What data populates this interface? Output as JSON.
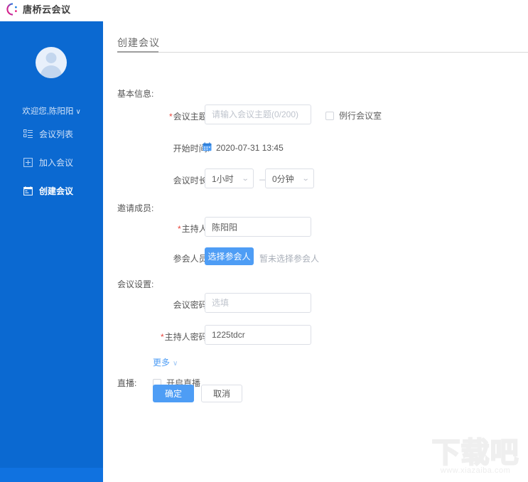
{
  "app": {
    "brand_name": "唐桥云会议",
    "logo_icon": "circle-c-logo-icon"
  },
  "sidebar": {
    "avatar_icon": "user-avatar-icon",
    "welcome_text": "欢迎您,陈阳阳",
    "welcome_chevron": "∨",
    "items": [
      {
        "label": "会议列表",
        "icon": "list-icon",
        "active": false
      },
      {
        "label": "加入会议",
        "icon": "plus-box-icon",
        "active": false
      },
      {
        "label": "创建会议",
        "icon": "calendar-create-icon",
        "active": true
      }
    ]
  },
  "main": {
    "page_title": "创建会议",
    "sections": {
      "basic_info": "基本信息:",
      "invite_members": "邀请成员:",
      "meeting_settings": "会议设置:"
    },
    "basic": {
      "subject_label": "会议主题:",
      "subject_required": "*",
      "subject_value": "",
      "subject_placeholder": "请输入会议主题(0/200)",
      "routine_room_label": "例行会议室",
      "routine_room_checked": false,
      "start_time_label": "开始时间:",
      "start_time_value": "2020-07-31 13:45",
      "calendar_icon": "calendar-icon",
      "duration_label": "会议时长:",
      "duration_hours": "1小时",
      "duration_minutes": "0分钟",
      "duration_separator": "—",
      "chevron_icon": "chevron-down-icon"
    },
    "invite": {
      "host_label": "主持人:",
      "host_required": "*",
      "host_value": "陈阳阳",
      "attendee_label": "参会人员:",
      "select_attendee_button": "选择参会人",
      "attendee_hint": "暂未选择参会人"
    },
    "settings": {
      "meeting_password_label": "会议密码:",
      "meeting_password_value": "",
      "meeting_password_placeholder": "选填",
      "host_password_label": "主持人密码:",
      "host_password_required": "*",
      "host_password_value": "1225tdcr",
      "more_label": "更多",
      "more_chevron": "∨"
    },
    "live": {
      "label": "直播:",
      "enable_label": "开启直播",
      "enable_checked": false
    },
    "actions": {
      "confirm": "确定",
      "cancel": "取消"
    }
  },
  "watermark": {
    "big_text": "下载吧",
    "small_text": "www.xiazaiba.com"
  },
  "colors": {
    "sidebar_blue": "#0b69d1",
    "bottom_strip_blue": "#1072e0",
    "primary_button": "#4e9df5",
    "required_red": "#e8453c",
    "link_blue": "#4e9df5"
  }
}
